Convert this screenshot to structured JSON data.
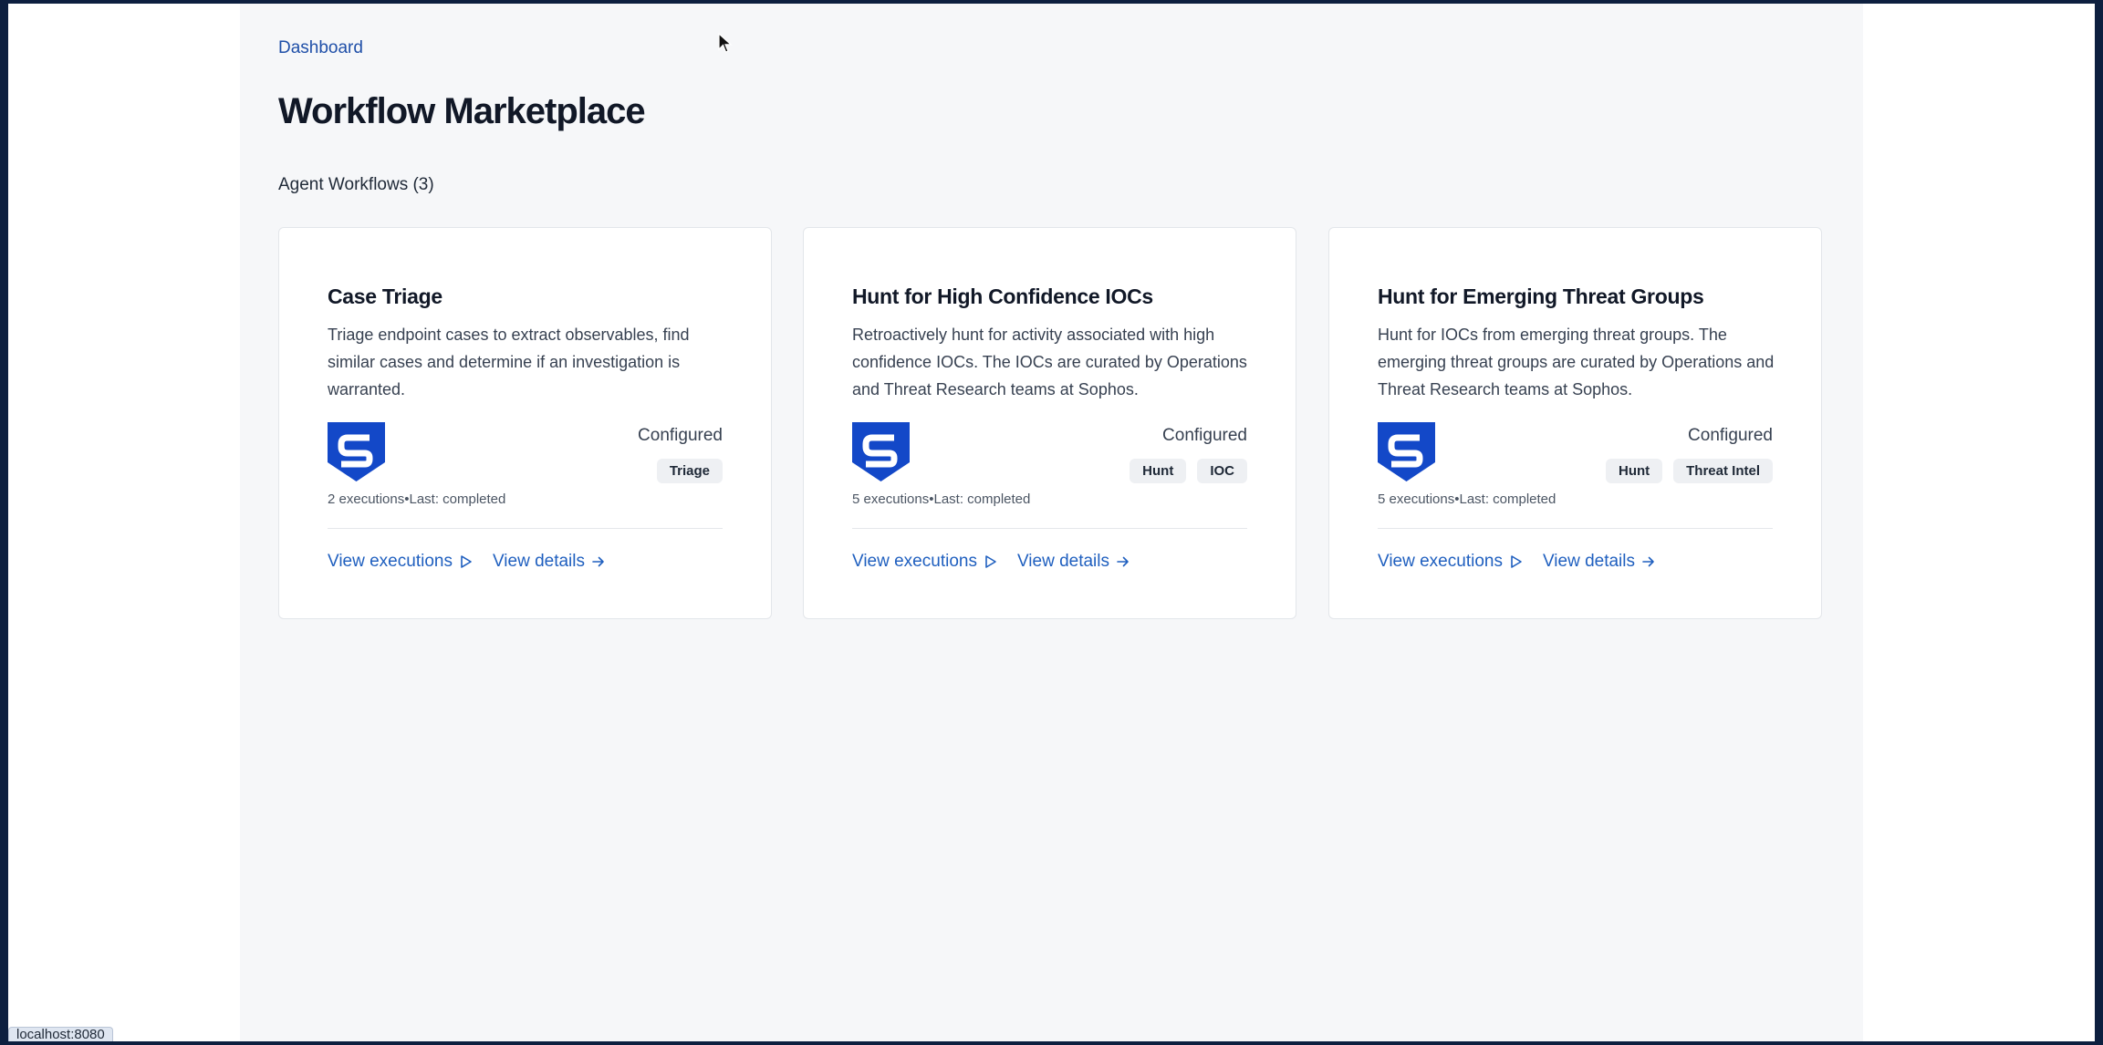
{
  "breadcrumb": "Dashboard",
  "page_title": "Workflow Marketplace",
  "section_label": "Agent Workflows (3)",
  "actions": {
    "view_executions": "View executions",
    "view_details": "View details"
  },
  "cards": [
    {
      "title": "Case Triage",
      "description": "Triage endpoint cases to extract observables, find similar cases and determine if an investigation is warranted.",
      "status": "Configured",
      "tags": [
        "Triage"
      ],
      "meta": "2 executions•Last: completed"
    },
    {
      "title": "Hunt for High Confidence IOCs",
      "description": "Retroactively hunt for activity associated with high confidence IOCs. The IOCs are curated by Operations and Threat Research teams at Sophos.",
      "status": "Configured",
      "tags": [
        "Hunt",
        "IOC"
      ],
      "meta": "5 executions•Last: completed"
    },
    {
      "title": "Hunt for Emerging Threat Groups",
      "description": "Hunt for IOCs from emerging threat groups. The emerging threat groups are curated by Operations and Threat Research teams at Sophos.",
      "status": "Configured",
      "tags": [
        "Hunt",
        "Threat Intel"
      ],
      "meta": "5 executions•Last: completed"
    }
  ],
  "status_bar_url": "localhost:8080",
  "colors": {
    "accent": "#1f5fbf",
    "logo_blue": "#1348c8",
    "outer_frame": "#0d1f3f"
  },
  "icons": {
    "logo": "sophos-s-shield-icon",
    "play": "play-outline-icon",
    "arrow": "arrow-right-icon",
    "cursor": "mouse-pointer-icon"
  }
}
